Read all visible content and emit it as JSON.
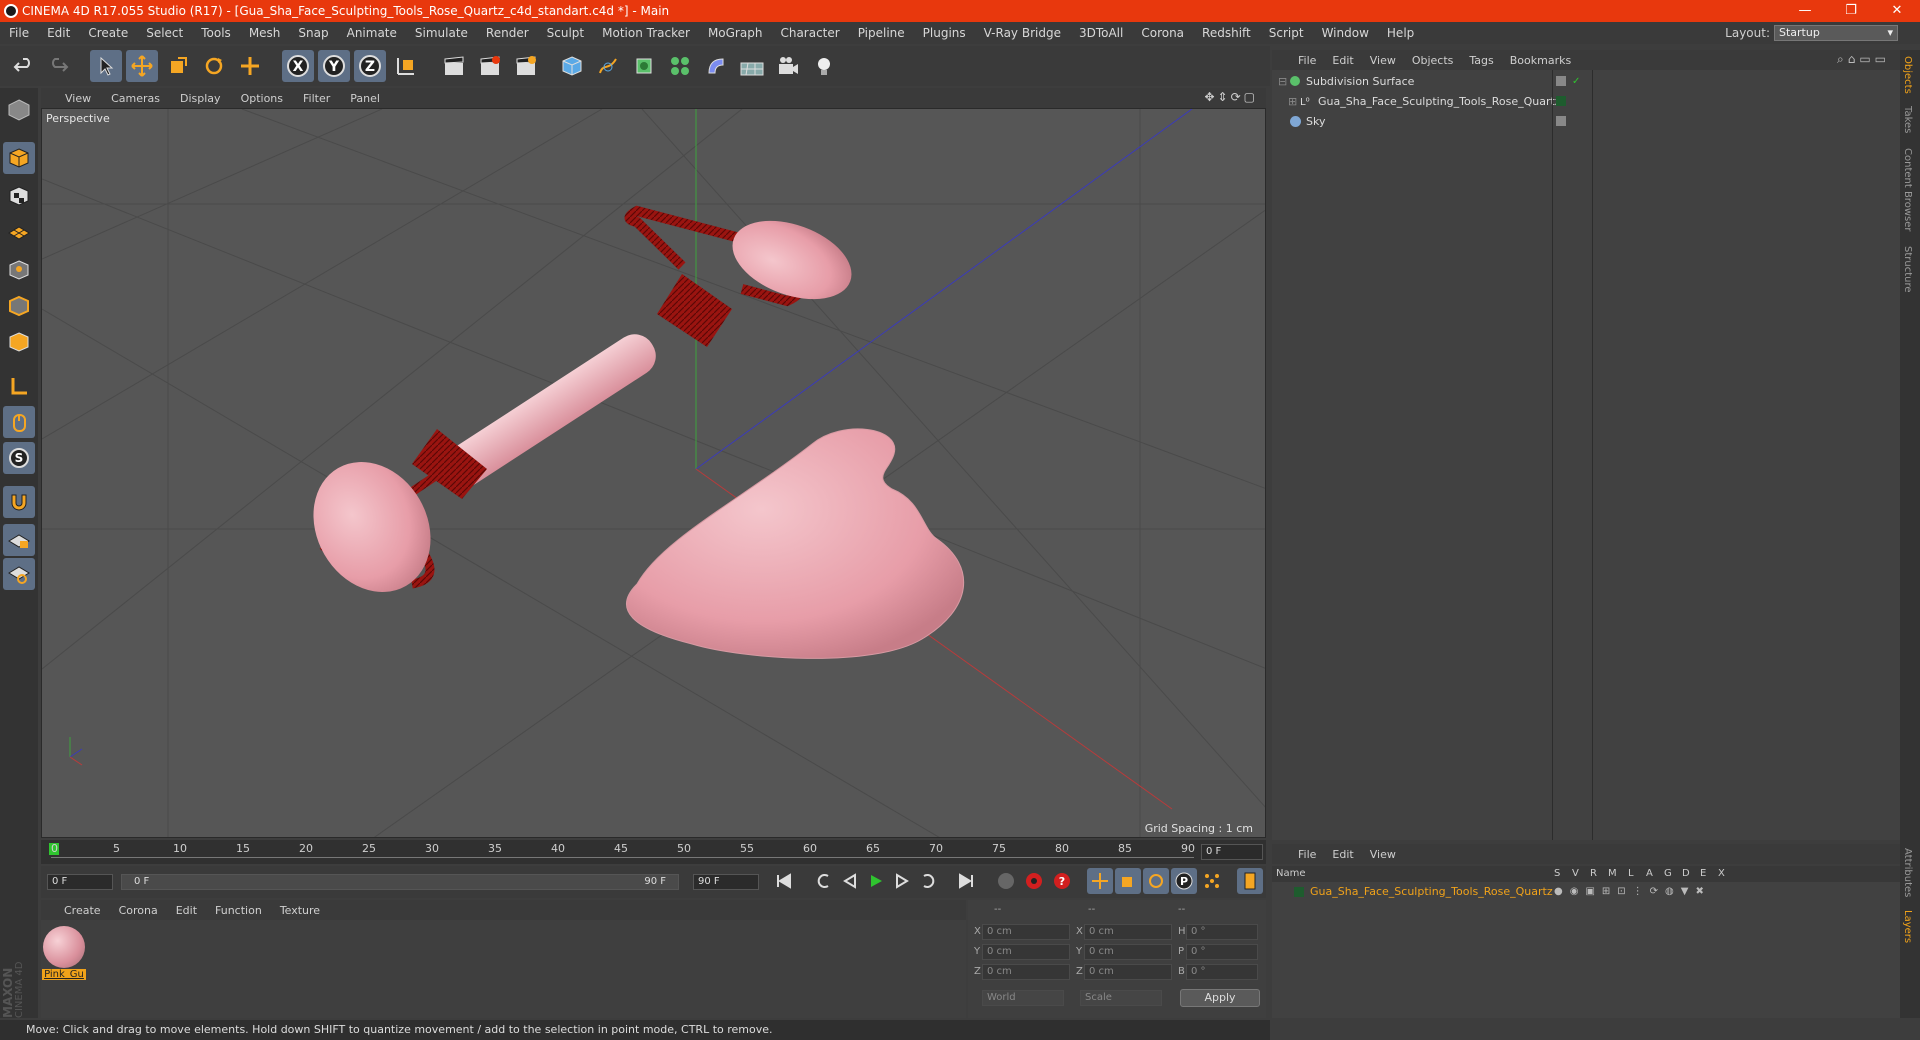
{
  "title_bar": {
    "text": "CINEMA 4D R17.055 Studio (R17) - [Gua_Sha_Face_Sculpting_Tools_Rose_Quartz_c4d_standart.c4d *] - Main",
    "minimize": "—",
    "restore": "❐",
    "close": "✕"
  },
  "menu": [
    "File",
    "Edit",
    "Create",
    "Select",
    "Tools",
    "Mesh",
    "Snap",
    "Animate",
    "Simulate",
    "Render",
    "Sculpt",
    "Motion Tracker",
    "MoGraph",
    "Character",
    "Pipeline",
    "Plugins",
    "V-Ray Bridge",
    "3DToAll",
    "Corona",
    "Redshift",
    "Script",
    "Window",
    "Help"
  ],
  "layout": {
    "label": "Layout:",
    "value": "Startup"
  },
  "viewport": {
    "menu": [
      "View",
      "Cameras",
      "Display",
      "Options",
      "Filter",
      "Panel"
    ],
    "label": "Perspective",
    "grid_spacing": "Grid Spacing : 1 cm"
  },
  "timeline": {
    "ticks": [
      "0",
      "5",
      "10",
      "15",
      "20",
      "25",
      "30",
      "35",
      "40",
      "45",
      "50",
      "55",
      "60",
      "65",
      "70",
      "75",
      "80",
      "85",
      "90"
    ],
    "current_frame": "0 F",
    "start": "0 F",
    "range_start": "0 F",
    "range_end": "90 F",
    "end": "90 F"
  },
  "material_manager": {
    "menu": [
      "Create",
      "Corona",
      "Edit",
      "Function",
      "Texture"
    ],
    "materials": [
      {
        "name": "Pink_Gu"
      }
    ]
  },
  "coordinates": {
    "header": [
      "--",
      "--",
      "--"
    ],
    "rows": [
      {
        "a": "X",
        "av": "0 cm",
        "b": "X",
        "bv": "0 cm",
        "c": "H",
        "cv": "0 °"
      },
      {
        "a": "Y",
        "av": "0 cm",
        "b": "Y",
        "bv": "0 cm",
        "c": "P",
        "cv": "0 °"
      },
      {
        "a": "Z",
        "av": "0 cm",
        "b": "Z",
        "bv": "0 cm",
        "c": "B",
        "cv": "0 °"
      }
    ],
    "mode1": "World",
    "mode2": "Scale",
    "apply": "Apply"
  },
  "status": "Move: Click and drag to move elements. Hold down SHIFT to quantize movement / add to the selection in point mode, CTRL to remove.",
  "object_manager": {
    "menu": [
      "File",
      "Edit",
      "View",
      "Objects",
      "Tags",
      "Bookmarks"
    ],
    "objects": [
      {
        "name": "Subdivision Surface"
      },
      {
        "name": "Gua_Sha_Face_Sculpting_Tools_Rose_Quartz"
      },
      {
        "name": "Sky"
      }
    ]
  },
  "right_tabs": [
    "Objects",
    "Takes",
    "Content Browser",
    "Structure",
    "Attributes",
    "Layers"
  ],
  "layers_manager": {
    "menu": [
      "File",
      "Edit",
      "View"
    ],
    "columns": [
      "Name",
      "S",
      "V",
      "R",
      "M",
      "L",
      "A",
      "G",
      "D",
      "E",
      "X"
    ],
    "layers": [
      {
        "name": "Gua_Sha_Face_Sculpting_Tools_Rose_Quartz"
      }
    ]
  },
  "brand": {
    "maxon": "MAXON",
    "c4d": "CINEMA 4D"
  },
  "colors": {
    "title": "#e8380d",
    "highlight": "#5e6f86",
    "layer_name": "#f0a21a"
  }
}
